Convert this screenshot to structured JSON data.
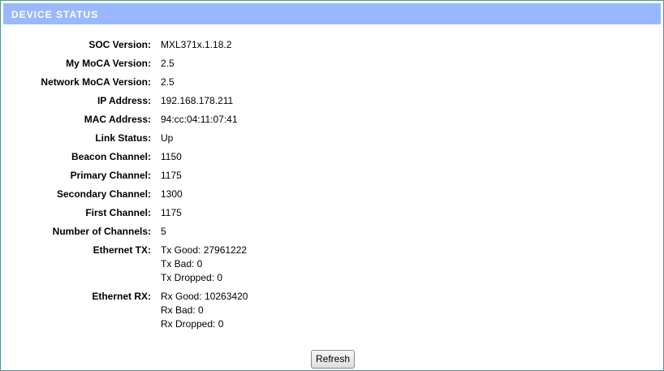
{
  "header": {
    "title": "DEVICE STATUS"
  },
  "status": {
    "soc_version": {
      "label": "SOC Version:",
      "value": "MXL371x.1.18.2"
    },
    "my_moca_version": {
      "label": "My MoCA Version:",
      "value": "2.5"
    },
    "network_moca_version": {
      "label": "Network MoCA Version:",
      "value": "2.5"
    },
    "ip_address": {
      "label": "IP Address:",
      "value": "192.168.178.211"
    },
    "mac_address": {
      "label": "MAC Address:",
      "value": "94:cc:04:11:07:41"
    },
    "link_status": {
      "label": "Link Status:",
      "value": "Up"
    },
    "beacon_channel": {
      "label": "Beacon Channel:",
      "value": "1150"
    },
    "primary_channel": {
      "label": "Primary Channel:",
      "value": "1175"
    },
    "secondary_channel": {
      "label": "Secondary Channel:",
      "value": "1300"
    },
    "first_channel": {
      "label": "First Channel:",
      "value": "1175"
    },
    "number_of_channels": {
      "label": "Number of Channels:",
      "value": "5"
    },
    "ethernet_tx": {
      "label": "Ethernet TX:",
      "lines": [
        "Tx Good: 27961222",
        "Tx Bad: 0",
        "Tx Dropped: 0"
      ]
    },
    "ethernet_rx": {
      "label": "Ethernet RX:",
      "lines": [
        "Rx Good: 10263420",
        "Rx Bad: 0",
        "Rx Dropped: 0"
      ]
    }
  },
  "actions": {
    "refresh_label": "Refresh"
  }
}
